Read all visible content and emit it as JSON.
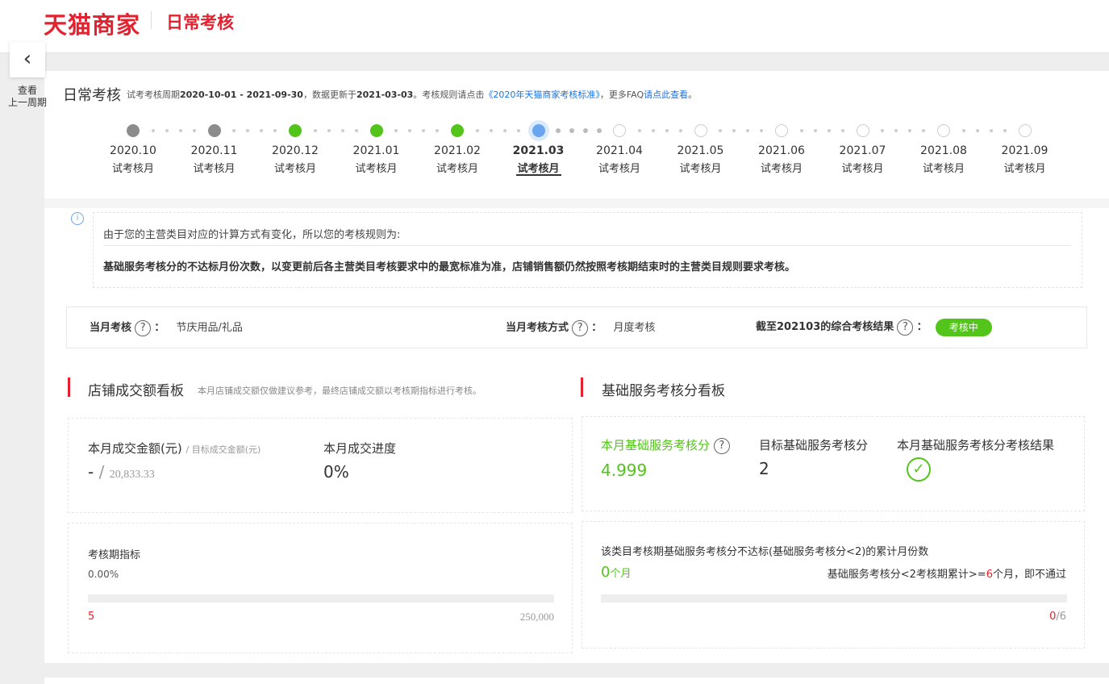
{
  "header": {
    "brand": "天猫商家",
    "page": "日常考核"
  },
  "panel": {
    "title": "日常考核",
    "info_prefix": "试考考核周期",
    "period": "2020-10-01 - 2021-09-30",
    "info_mid": "，数据更新于",
    "update_date": "2021-03-03",
    "info_rule": "。考核规则请点击",
    "rule_link": "《2020年天猫商家考核标准》",
    "info_faq": "，更多FAQ",
    "faq_link": "请点此查看",
    "info_end": "。"
  },
  "prev": {
    "icon": "chevron-left-icon",
    "text_line1": "查看",
    "text_line2": "上一周期"
  },
  "months": [
    {
      "month": "2020.10",
      "type": "试考核月",
      "state": "past-gray"
    },
    {
      "month": "2020.11",
      "type": "试考核月",
      "state": "past-gray"
    },
    {
      "month": "2020.12",
      "type": "试考核月",
      "state": "passed"
    },
    {
      "month": "2021.01",
      "type": "试考核月",
      "state": "passed"
    },
    {
      "month": "2021.02",
      "type": "试考核月",
      "state": "passed"
    },
    {
      "month": "2021.03",
      "type": "试考核月",
      "state": "current"
    },
    {
      "month": "2021.04",
      "type": "试考核月",
      "state": "future"
    },
    {
      "month": "2021.05",
      "type": "试考核月",
      "state": "future"
    },
    {
      "month": "2021.06",
      "type": "试考核月",
      "state": "future"
    },
    {
      "month": "2021.07",
      "type": "试考核月",
      "state": "future"
    },
    {
      "month": "2021.08",
      "type": "试考核月",
      "state": "future"
    },
    {
      "month": "2021.09",
      "type": "试考核月",
      "state": "future"
    }
  ],
  "notice": {
    "icon": "info-icon",
    "line1": "由于您的主营类目对应的计算方式有变化，所以您的考核规则为:",
    "line2": "基础服务考核分的不达标月份次数，以变更前后各主营类目考核要求中的最宽标准为准，店铺销售额仍然按照考核期结束时的主营类目规则要求考核。"
  },
  "current": {
    "label1": "当月考核",
    "value1": "节庆用品/礼品",
    "label2": "当月考核方式",
    "value2": "月度考核",
    "label3": "截至202103的综合考核结果",
    "badge": "考核中",
    "help_icon": "question-icon",
    "colon": "："
  },
  "sales": {
    "title": "店铺成交额看板",
    "note": "本月店铺成交额仅做建议参考，最终店铺成交额以考核期指标进行考核。",
    "amount_label": "本月成交金额(元)",
    "target_label": "/ 目标成交金额(元)",
    "amount_value": "-",
    "slash": "/",
    "target_value": "20,833.33",
    "progress_label": "本月成交进度",
    "progress_value": "0%",
    "period_label": "考核期指标",
    "period_value": "0.00%",
    "bar_min": "5",
    "bar_max": "250,000",
    "bar_fill": 0
  },
  "service": {
    "title": "基础服务考核分看板",
    "score_label": "本月基础服务考核分",
    "score_value": "4.999",
    "target_label": "目标基础服务考核分",
    "target_value": "2",
    "result_label": "本月基础服务考核分考核结果",
    "result_icon": "check-circle-icon",
    "fail_label": "该类目考核期基础服务考核分不达标(基础服务考核分<2)的累计月份数",
    "fail_count": "0",
    "fail_unit": "个月",
    "rule_prefix": "基础服务考核分<2考核期累计>=",
    "rule_count": "6",
    "rule_suffix": "个月，即不通过",
    "progress_now": "0",
    "progress_total": "/6",
    "bar_fill": 0
  },
  "colors": {
    "brand_red": "#e4212f",
    "green": "#52c41a",
    "blue": "#6aa6ef",
    "link": "#1a73e8"
  }
}
